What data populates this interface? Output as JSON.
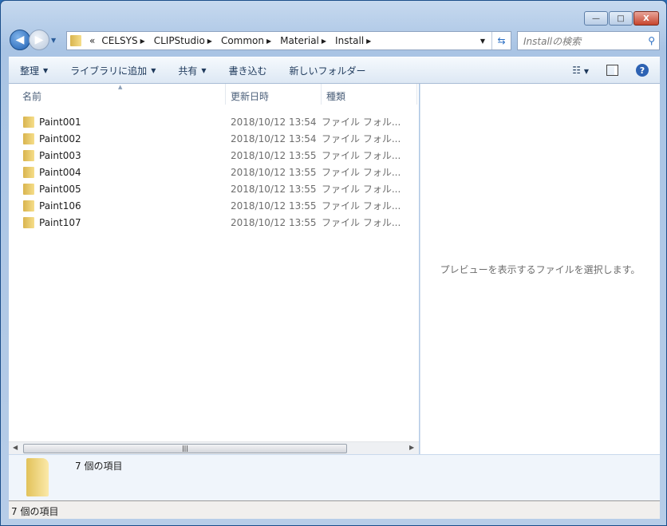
{
  "window": {
    "minimize": "—",
    "maximize": "□",
    "close": "X"
  },
  "nav": {
    "back": "◀",
    "forward": "▶"
  },
  "address": {
    "overflow": "«",
    "crumbs": [
      "CELSYS",
      "CLIPStudio",
      "Common",
      "Material",
      "Install"
    ]
  },
  "search": {
    "placeholder": "Installの検索"
  },
  "toolbar": {
    "organize": "整理",
    "add_library": "ライブラリに追加",
    "share": "共有",
    "burn": "書き込む",
    "new_folder": "新しいフォルダー"
  },
  "columns": {
    "name": "名前",
    "date": "更新日時",
    "type": "種類"
  },
  "files": [
    {
      "name": "Paint001",
      "date": "2018/10/12 13:54",
      "type": "ファイル フォル..."
    },
    {
      "name": "Paint002",
      "date": "2018/10/12 13:54",
      "type": "ファイル フォル..."
    },
    {
      "name": "Paint003",
      "date": "2018/10/12 13:55",
      "type": "ファイル フォル..."
    },
    {
      "name": "Paint004",
      "date": "2018/10/12 13:55",
      "type": "ファイル フォル..."
    },
    {
      "name": "Paint005",
      "date": "2018/10/12 13:55",
      "type": "ファイル フォル..."
    },
    {
      "name": "Paint106",
      "date": "2018/10/12 13:55",
      "type": "ファイル フォル..."
    },
    {
      "name": "Paint107",
      "date": "2018/10/12 13:55",
      "type": "ファイル フォル..."
    }
  ],
  "preview": {
    "message": "プレビューを表示するファイルを選択します。"
  },
  "details": {
    "count": "7 個の項目"
  },
  "status": {
    "count": "7 個の項目"
  }
}
